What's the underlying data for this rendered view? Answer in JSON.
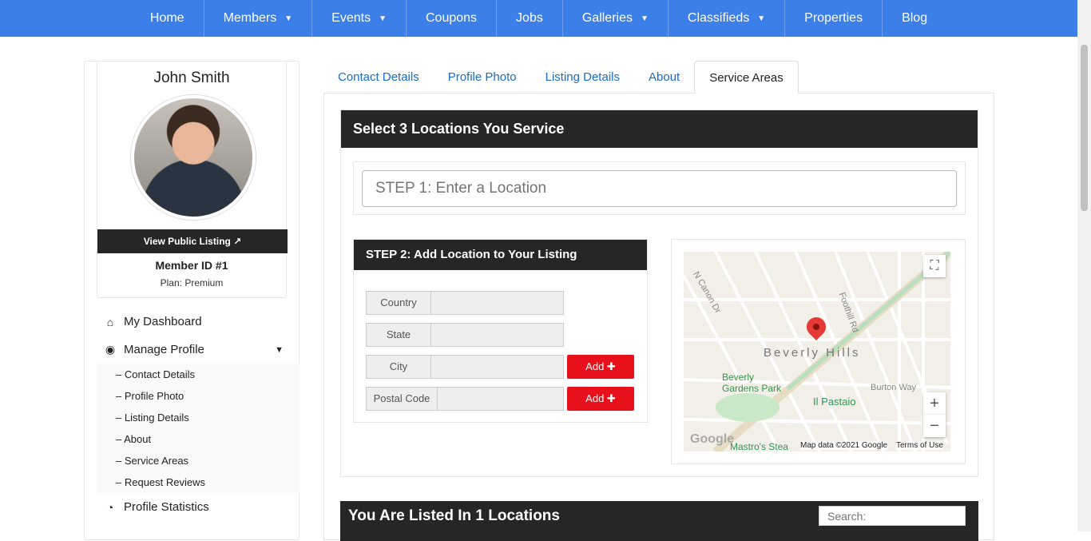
{
  "nav": {
    "items": [
      {
        "label": "Home",
        "caret": ""
      },
      {
        "label": "Members",
        "caret": "▼"
      },
      {
        "label": "Events",
        "caret": "▼"
      },
      {
        "label": "Coupons",
        "caret": ""
      },
      {
        "label": "Jobs",
        "caret": ""
      },
      {
        "label": "Galleries",
        "caret": "▼"
      },
      {
        "label": "Classifieds",
        "caret": "▼"
      },
      {
        "label": "Properties",
        "caret": ""
      },
      {
        "label": "Blog",
        "caret": ""
      }
    ]
  },
  "profile": {
    "name": "John Smith",
    "view_public_label": "View Public Listing",
    "member_id": "Member ID #1",
    "plan": "Plan: Premium"
  },
  "sidebar": {
    "dashboard": "My Dashboard",
    "manage_profile": "Manage Profile",
    "sub_items": [
      "– Contact Details",
      "– Profile Photo",
      "– Listing Details",
      "– About",
      "– Service Areas",
      "– Request Reviews"
    ],
    "profile_statistics": "Profile Statistics"
  },
  "tabs": [
    "Contact Details",
    "Profile Photo",
    "Listing Details",
    "About",
    "Service Areas"
  ],
  "service": {
    "title": "Select 3 Locations You Service",
    "step1_placeholder": "STEP 1: Enter a Location",
    "step2_title": "STEP 2: Add Location to Your Listing",
    "fields": {
      "country": "Country",
      "state": "State",
      "city": "City",
      "postal": "Postal Code"
    },
    "add_label": "Add ✚"
  },
  "map": {
    "city_label": "Beverly Hills",
    "park_label": "Beverly Gardens Park",
    "poi_1": "Il Pastaio",
    "poi_2": "Mastro's Stea",
    "road_1": "Burton Way",
    "road_2": "N Canon Dr",
    "road_3": "Foothill Rd",
    "map_data": "Map data ©2021 Google",
    "terms": "Terms of Use",
    "google": "Google"
  },
  "listed": {
    "title": "You Are Listed In 1 Locations",
    "search_placeholder": "Search:"
  },
  "colors": {
    "nav_bg": "#3d7fe9",
    "dark_header": "#262626",
    "add_button": "#e8101a",
    "link": "#1a6cc8"
  }
}
